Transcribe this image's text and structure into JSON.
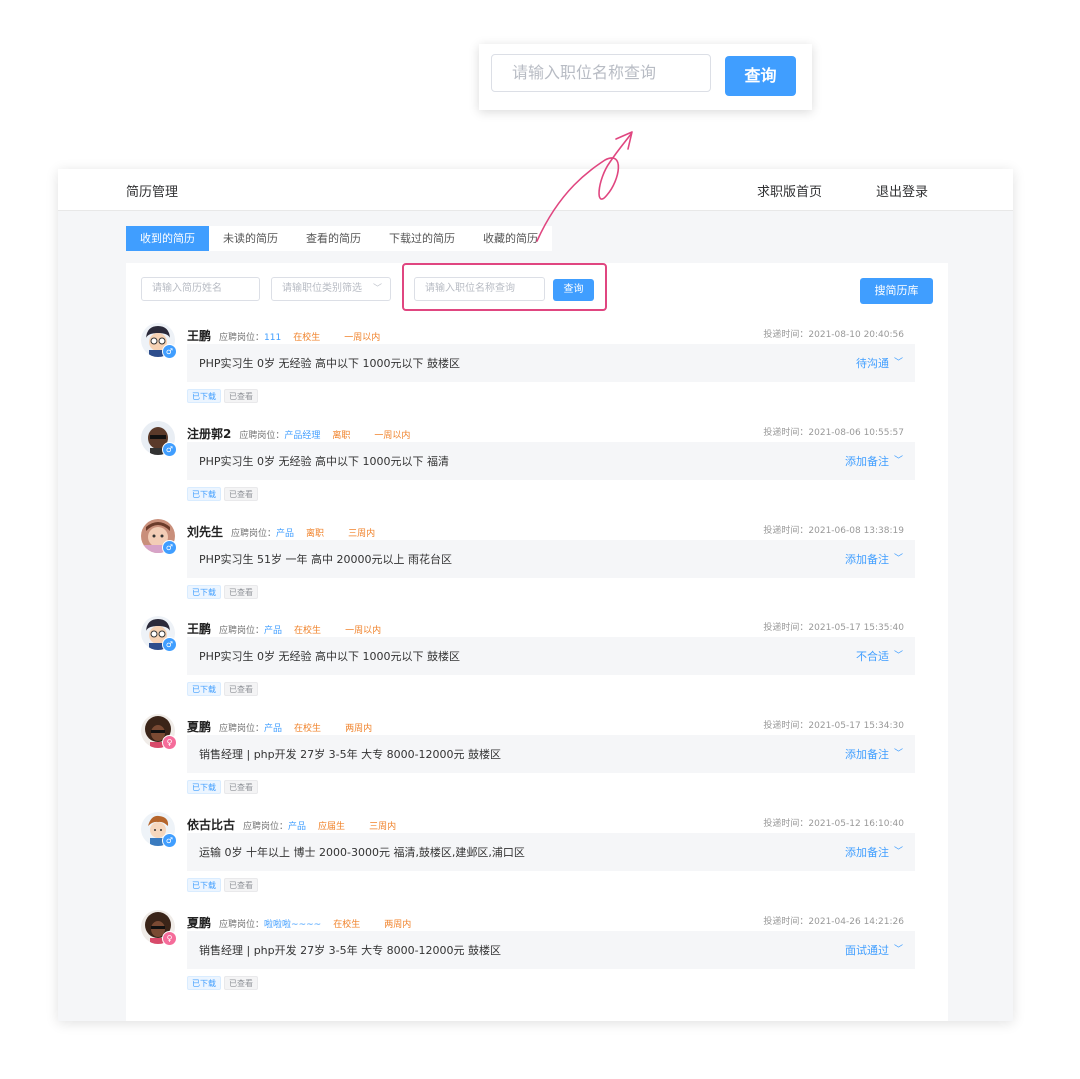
{
  "callout": {
    "input_placeholder": "请输入职位名称查询",
    "button_label": "查询"
  },
  "header": {
    "title": "简历管理",
    "nav_home": "求职版首页",
    "nav_logout": "退出登录"
  },
  "tabs": [
    {
      "label": "收到的简历",
      "active": true
    },
    {
      "label": "未读的简历",
      "active": false
    },
    {
      "label": "查看的简历",
      "active": false
    },
    {
      "label": "下载过的简历",
      "active": false
    },
    {
      "label": "收藏的简历",
      "active": false
    }
  ],
  "filters": {
    "name_placeholder": "请输入简历姓名",
    "category_placeholder": "请输职位类别筛选",
    "position_placeholder": "请输入职位名称查询",
    "query_label": "查询",
    "library_label": "搜简历库"
  },
  "labels": {
    "apply_position": "应聘岗位：",
    "tag_downloaded": "已下载",
    "tag_viewed": "已查看"
  },
  "entries": [
    {
      "name": "王鹏",
      "position": "111",
      "status": "在校生",
      "period": "一周以内",
      "time": "投递时间：2021-08-10 20:40:56",
      "detail": "PHP实习生   0岁   无经验   高中以下   1000元以下   鼓楼区",
      "action": "待沟通",
      "gender": "male",
      "avatar": "conan"
    },
    {
      "name": "注册郭2",
      "position": "产品经理",
      "status": "离职",
      "period": "一周以内",
      "time": "投递时间：2021-08-06 10:55:57",
      "detail": "PHP实习生   0岁   无经验   高中以下   1000元以下   福清",
      "action": "添加备注",
      "gender": "male",
      "avatar": "dark"
    },
    {
      "name": "刘先生",
      "position": "产品",
      "status": "离职",
      "period": "三周内",
      "time": "投递时间：2021-06-08 13:38:19",
      "detail": "PHP实习生   51岁   一年   高中   20000元以上   雨花台区",
      "action": "添加备注",
      "gender": "male",
      "avatar": "photo"
    },
    {
      "name": "王鹏",
      "position": "产品",
      "status": "在校生",
      "period": "一周以内",
      "time": "投递时间：2021-05-17 15:35:40",
      "detail": "PHP实习生   0岁   无经验   高中以下   1000元以下   鼓楼区",
      "action": "不合适",
      "gender": "male",
      "avatar": "conan"
    },
    {
      "name": "夏鹏",
      "position": "产品",
      "status": "在校生",
      "period": "两周内",
      "time": "投递时间：2021-05-17 15:34:30",
      "detail": "销售经理 | php开发   27岁   3-5年   大专   8000-12000元   鼓楼区",
      "action": "添加备注",
      "gender": "female",
      "avatar": "curly"
    },
    {
      "name": "依古比古",
      "position": "产品",
      "status": "应届生",
      "period": "三周内",
      "time": "投递时间：2021-05-12 16:10:40",
      "detail": "运输   0岁   十年以上   博士   2000-3000元   福清,鼓楼区,建邺区,浦口区",
      "action": "添加备注",
      "gender": "male",
      "avatar": "boy"
    },
    {
      "name": "夏鹏",
      "position": "啦啦啦~~~~",
      "status": "在校生",
      "period": "两周内",
      "time": "投递时间：2021-04-26 14:21:26",
      "detail": "销售经理 | php开发   27岁   3-5年   大专   8000-12000元   鼓楼区",
      "action": "面试通过",
      "gender": "female",
      "avatar": "curly"
    }
  ],
  "colors": {
    "accent": "#409eff",
    "highlight": "#e04680",
    "status_orange": "#f0822a"
  },
  "icons": {
    "dropdown": "chevron-down-icon",
    "arrow": "curved-arrow-icon"
  }
}
